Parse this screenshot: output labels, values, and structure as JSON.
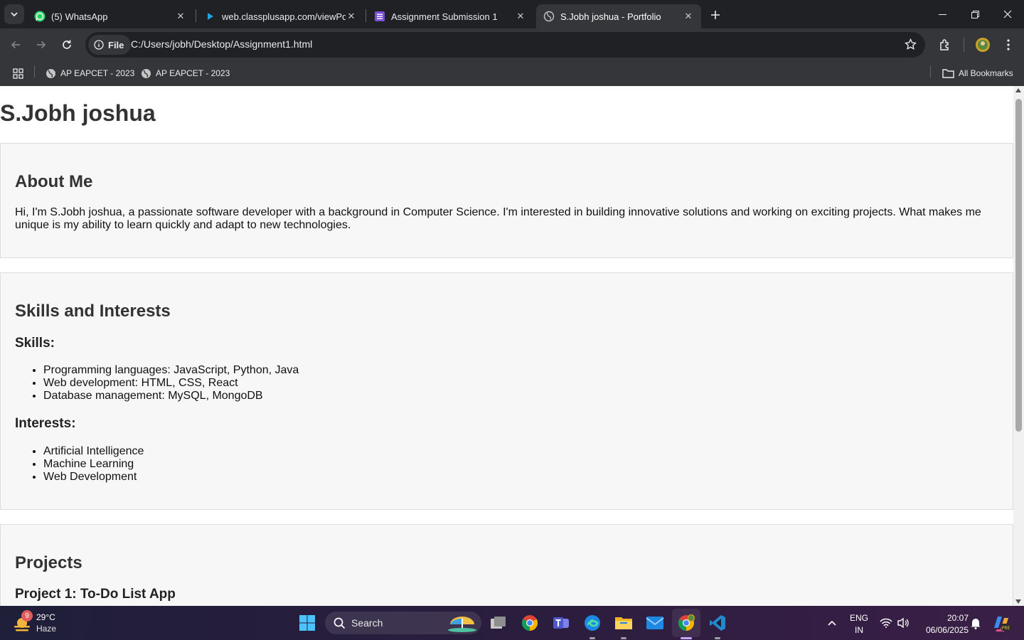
{
  "browser": {
    "tabs": [
      {
        "title": "(5) WhatsApp",
        "favicon": "whatsapp-icon"
      },
      {
        "title": "web.classplusapp.com/viewPdf",
        "favicon": "classplus-icon"
      },
      {
        "title": "Assignment Submission 1",
        "favicon": "forms-icon"
      },
      {
        "title": "S.Jobh joshua - Portfolio",
        "favicon": "globe-icon",
        "active": true
      }
    ],
    "omnibox": {
      "chip_label": "File",
      "url": "C:/Users/jobh/Desktop/Assignment1.html"
    },
    "bookmarks": [
      {
        "label": "AP EAPCET - 2023"
      },
      {
        "label": "AP EAPCET - 2023"
      }
    ],
    "all_bookmarks_label": "All Bookmarks"
  },
  "page": {
    "name": "S.Jobh joshua",
    "about": {
      "heading": "About Me",
      "text": "Hi, I'm S.Jobh joshua, a passionate software developer with a background in Computer Science. I'm interested in building innovative solutions and working on exciting projects. What makes me unique is my ability to learn quickly and adapt to new technologies."
    },
    "skills_interests": {
      "heading": "Skills and Interests",
      "skills_heading": "Skills:",
      "skills": [
        "Programming languages: JavaScript, Python, Java",
        "Web development: HTML, CSS, React",
        "Database management: MySQL, MongoDB"
      ],
      "interests_heading": "Interests:",
      "interests": [
        "Artificial Intelligence",
        "Machine Learning",
        "Web Development"
      ]
    },
    "projects": {
      "heading": "Projects",
      "project1_title": "Project 1: To-Do List App"
    }
  },
  "taskbar": {
    "weather": {
      "temp": "29°C",
      "condition": "Haze",
      "badge": "9"
    },
    "search_label": "Search",
    "lang_top": "ENG",
    "lang_bottom": "IN",
    "time": "20:07",
    "date": "06/06/2025"
  },
  "colors": {
    "tab_bg": "#202124",
    "toolbar_bg": "#35363a",
    "section_bg": "#f7f7f7",
    "section_border": "#dddddd"
  }
}
